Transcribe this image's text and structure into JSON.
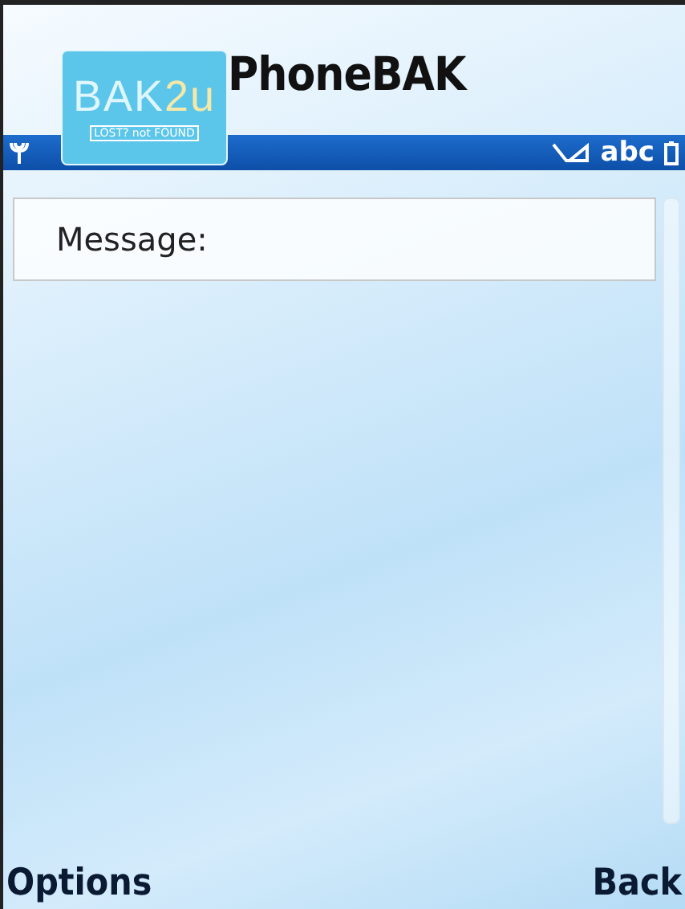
{
  "header": {
    "logo": {
      "main": "BAK",
      "accent": "2u",
      "tagline": "LOST? not FOUND"
    },
    "title": "PhoneBAK"
  },
  "status_bar": {
    "input_mode": "abc"
  },
  "form": {
    "field_label": "Message:"
  },
  "softkeys": {
    "left": "Options",
    "right": "Back"
  }
}
